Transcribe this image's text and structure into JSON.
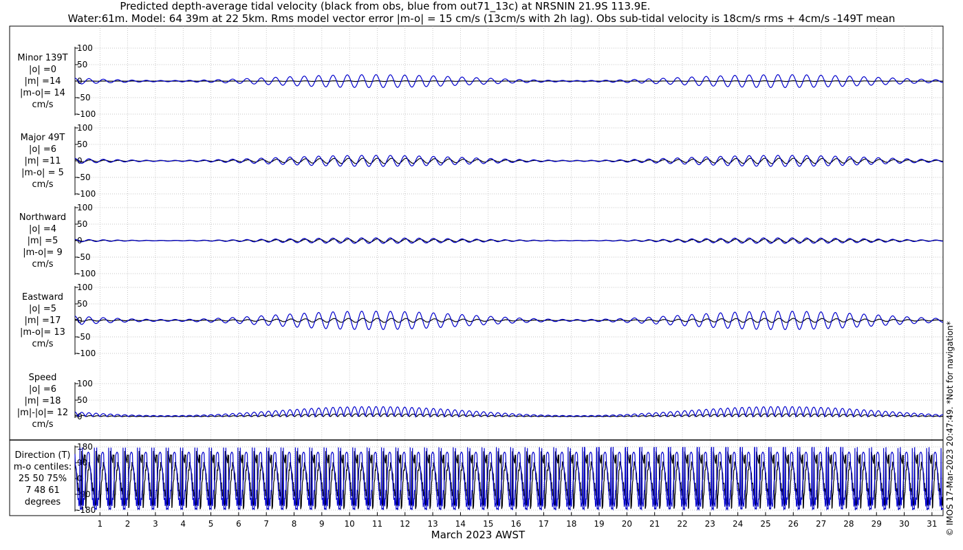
{
  "title_line1": "Predicted depth-average tidal velocity (black from obs, blue from out71_13c) at NRSNIN 21.9S 113.9E.",
  "title_line2": "Water:61m. Model: 64 39m at 22 5km. Rms model vector error |m-o| = 15 cm/s (13cm/s with 2h lag). Obs sub-tidal velocity is 18cm/s rms + 4cm/s -149T mean",
  "watermark": "© IMOS 17-Mar-2023 20:47:49. *Not for navigation*",
  "colors": {
    "obs": "#000000",
    "model": "#0000cc",
    "grid": "#b0b0b0"
  },
  "chart_data": {
    "type": "line",
    "xlabel": "March 2023 AWST",
    "x_ticks": [
      1,
      2,
      3,
      4,
      5,
      6,
      7,
      8,
      9,
      10,
      11,
      12,
      13,
      14,
      15,
      16,
      17,
      18,
      19,
      20,
      21,
      22,
      23,
      24,
      25,
      26,
      27,
      28,
      29,
      30,
      31
    ],
    "xlim": [
      0.1,
      31.4
    ],
    "series_names": {
      "obs": "obs",
      "model": "out71_13c"
    },
    "panels": [
      {
        "id": "minor",
        "label_lines": [
          "Minor 139T",
          "|o| =0",
          "|m| =14",
          "|m-o|= 14",
          "cm/s"
        ],
        "ylim": [
          -100,
          100
        ],
        "yticks": [
          100,
          50,
          0,
          -50,
          -100
        ],
        "obs_amp": 1,
        "model_amp": 14
      },
      {
        "id": "major",
        "label_lines": [
          "Major 49T",
          "|o| =6",
          "|m| =11",
          "|m-o| = 5",
          "cm/s"
        ],
        "ylim": [
          -100,
          100
        ],
        "yticks": [
          100,
          50,
          0,
          -50,
          -100
        ],
        "obs_amp": 8,
        "model_amp": 12
      },
      {
        "id": "north",
        "label_lines": [
          "Northward",
          "|o| =4",
          "|m| =5",
          "|m-o|= 9",
          "cm/s"
        ],
        "ylim": [
          -100,
          100
        ],
        "yticks": [
          100,
          50,
          0,
          -50,
          -100
        ],
        "obs_amp": 5,
        "model_amp": 6
      },
      {
        "id": "east",
        "label_lines": [
          "Eastward",
          "|o| =5",
          "|m| =17",
          "|m-o|= 13",
          "cm/s"
        ],
        "ylim": [
          -100,
          100
        ],
        "yticks": [
          100,
          50,
          0,
          -50,
          -100
        ],
        "obs_amp": 6,
        "model_amp": 20
      },
      {
        "id": "speed",
        "label_lines": [
          "Speed",
          "|o| =6",
          "|m| =18",
          "|m|-|o|= 12",
          "cm/s"
        ],
        "ylim": [
          0,
          100
        ],
        "yticks": [
          100,
          50,
          0
        ],
        "obs_amp": 7,
        "model_amp": 19
      },
      {
        "id": "direction",
        "label_lines": [
          "Direction (T)",
          "m-o centiles:",
          "25  50  75%",
          "7  48  61",
          "degrees"
        ],
        "ylim": [
          -180,
          180
        ],
        "yticks": [
          180,
          90,
          0,
          -90,
          -180
        ]
      }
    ]
  }
}
